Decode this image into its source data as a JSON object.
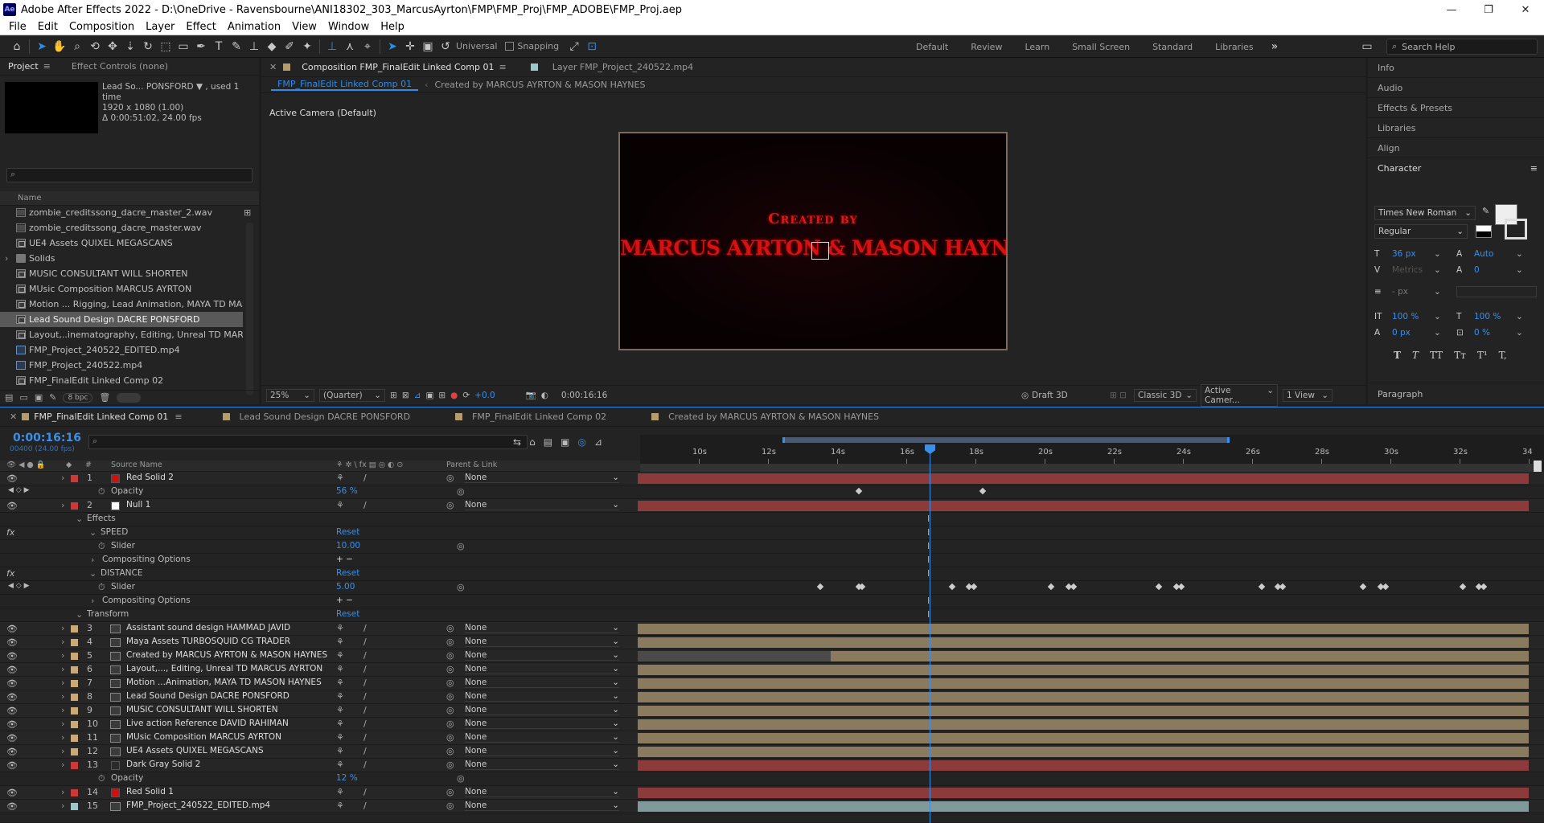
{
  "app": {
    "logo": "Ae",
    "title": "Adobe After Effects 2022 - D:\\OneDrive - Ravensbourne\\ANI18302_303_MarcusAyrton\\FMP\\FMP_Proj\\FMP_ADOBE\\FMP_Proj.aep"
  },
  "menu": [
    "File",
    "Edit",
    "Composition",
    "Layer",
    "Effect",
    "Animation",
    "View",
    "Window",
    "Help"
  ],
  "toolbar": {
    "universal": "Universal",
    "snapping": "Snapping",
    "workspaces": [
      "Default",
      "Review",
      "Learn",
      "Small Screen",
      "Standard",
      "Libraries"
    ],
    "more": "»",
    "search_placeholder": "Search Help"
  },
  "project": {
    "tabs": [
      "Project",
      "Effect Controls (none)"
    ],
    "preview_info": [
      "Lead So... PONSFORD ▼ , used 1 time",
      "1920 x 1080 (1.00)",
      "Δ 0:00:51:02, 24.00 fps"
    ],
    "name_header": "Name",
    "items": [
      {
        "label": "zombie_creditssong_dacre_master_2.wav",
        "type": "wav"
      },
      {
        "label": "zombie_creditssong_dacre_master.wav",
        "type": "wav"
      },
      {
        "label": "UE4 Assets QUIXEL MEGASCANS",
        "type": "comp"
      },
      {
        "label": "Solids",
        "type": "folder"
      },
      {
        "label": "MUSIC CONSULTANT WILL SHORTEN",
        "type": "comp"
      },
      {
        "label": "MUsic Composition MARCUS AYRTON",
        "type": "comp"
      },
      {
        "label": "Motion ... Rigging,  Lead Animation, MAYA TD MASON",
        "type": "comp"
      },
      {
        "label": "Lead Sound Design DACRE PONSFORD",
        "type": "comp",
        "selected": true
      },
      {
        "label": "Layout,..inematography, Editing, Unreal TD MARCUS A",
        "type": "comp"
      },
      {
        "label": "FMP_Project_240522_EDITED.mp4",
        "type": "mp4"
      },
      {
        "label": "FMP_Project_240522.mp4",
        "type": "mp4"
      },
      {
        "label": "FMP_FinalEdit Linked Comp 02",
        "type": "comp"
      }
    ],
    "bpc": "8 bpc"
  },
  "viewer": {
    "tabs": [
      "Composition FMP_FinalEdit Linked Comp 01",
      "Layer FMP_Project_240522.mp4"
    ],
    "breadcrumb": [
      "FMP_FinalEdit Linked Comp 01",
      "Created by MARCUS AYRTON & MASON HAYNES"
    ],
    "camera": "Active Camera (Default)",
    "credit_line1": "Created by",
    "credit_line2": "MARCUS AYRTON & MASON HAYNES",
    "zoom": "25%",
    "resolution": "(Quarter)",
    "exposure": "+0.0",
    "timecode": "0:00:16:16",
    "renderer_label": "Draft 3D",
    "renderer": "Classic 3D",
    "camera_select": "Active Camer...",
    "views": "1 View"
  },
  "right_panel": {
    "items": [
      "Info",
      "Audio",
      "Effects & Presets",
      "Libraries",
      "Align"
    ],
    "character": {
      "title": "Character",
      "font": "Times New Roman",
      "style": "Regular",
      "size": "36 px",
      "leading": "Auto",
      "kerning": "Metrics",
      "tracking": "0",
      "stroke": "- px",
      "vscale": "100 %",
      "hscale": "100 %",
      "baseline": "0 px",
      "tsume": "0 %",
      "styles": [
        "T",
        "T",
        "TT",
        "Tт",
        "T¹",
        "T,"
      ]
    },
    "paragraph": "Paragraph"
  },
  "timeline": {
    "tabs": [
      "FMP_FinalEdit Linked Comp 01",
      "Lead Sound Design DACRE PONSFORD",
      "FMP_FinalEdit Linked Comp 02",
      "Created by MARCUS AYRTON & MASON HAYNES"
    ],
    "timecode": "0:00:16:16",
    "frames": "00400 (24.00 fps)",
    "columns": {
      "hash": "#",
      "source": "Source Name",
      "parent": "Parent & Link"
    },
    "ruler": [
      "10s",
      "12s",
      "14s",
      "16s",
      "18s",
      "20s",
      "22s",
      "24s",
      "26s",
      "28s",
      "30s",
      "32s",
      "34"
    ],
    "rows": [
      {
        "num": "1",
        "name": "Red Solid 2",
        "label": "#c93a3a",
        "swatch": "#d01010",
        "parent": "None",
        "bar": "#8c3a3a",
        "kind": "layer"
      },
      {
        "name": "Opacity",
        "value": "56 %",
        "kind": "prop"
      },
      {
        "num": "2",
        "name": "Null 1",
        "label": "#c93a3a",
        "swatch": "#ffffff",
        "parent": "None",
        "bar": "#8c3a3a",
        "kind": "layer"
      },
      {
        "name": "Effects",
        "kind": "group"
      },
      {
        "name": "SPEED",
        "value": "Reset",
        "kind": "effect"
      },
      {
        "name": "Slider",
        "value": "10.00",
        "kind": "prop"
      },
      {
        "name": "Compositing Options",
        "value": "+ −",
        "kind": "sub"
      },
      {
        "name": "DISTANCE",
        "value": "Reset",
        "kind": "effect"
      },
      {
        "name": "Slider",
        "value": "5.00",
        "kind": "prop"
      },
      {
        "name": "Compositing Options",
        "value": "+ −",
        "kind": "sub"
      },
      {
        "name": "Transform",
        "value": "Reset",
        "kind": "group"
      },
      {
        "num": "3",
        "name": "Assistant sound design HAMMAD JAVID",
        "label": "#c9a97a",
        "parent": "None",
        "bar": "#8a7a5e",
        "kind": "layer"
      },
      {
        "num": "4",
        "name": " Maya Assets TURBOSQUID CG TRADER",
        "label": "#c9a97a",
        "parent": "None",
        "bar": "#8a7a5e",
        "kind": "layer"
      },
      {
        "num": "5",
        "name": "Created by MARCUS AYRTON & MASON HAYNES",
        "label": "#c9a97a",
        "parent": "None",
        "bar": "#8a7a5e",
        "kind": "layer"
      },
      {
        "num": "6",
        "name": "Layout,..., Editing, Unreal TD MARCUS AYRTON",
        "label": "#c9a97a",
        "parent": "None",
        "bar": "#8a7a5e",
        "kind": "layer"
      },
      {
        "num": "7",
        "name": "Motion ...Animation, MAYA TD MASON HAYNES",
        "label": "#c9a97a",
        "parent": "None",
        "bar": "#8a7a5e",
        "kind": "layer"
      },
      {
        "num": "8",
        "name": "Lead Sound Design DACRE PONSFORD",
        "label": "#c9a97a",
        "parent": "None",
        "bar": "#8a7a5e",
        "kind": "layer"
      },
      {
        "num": "9",
        "name": "MUSIC CONSULTANT WILL SHORTEN",
        "label": "#c9a97a",
        "parent": "None",
        "bar": "#8a7a5e",
        "kind": "layer"
      },
      {
        "num": "10",
        "name": " Live action Reference DAVID RAHIMAN",
        "label": "#c9a97a",
        "parent": "None",
        "bar": "#8a7a5e",
        "kind": "layer"
      },
      {
        "num": "11",
        "name": "MUsic Composition MARCUS AYRTON",
        "label": "#c9a97a",
        "parent": "None",
        "bar": "#8a7a5e",
        "kind": "layer"
      },
      {
        "num": "12",
        "name": "UE4 Assets QUIXEL MEGASCANS",
        "label": "#c9a97a",
        "parent": "None",
        "bar": "#8a7a5e",
        "kind": "layer"
      },
      {
        "num": "13",
        "name": "Dark Gray Solid 2",
        "label": "#c93a3a",
        "swatch": "#2a2a2a",
        "parent": "None",
        "bar": "#8c3a3a",
        "kind": "layer"
      },
      {
        "name": "Opacity",
        "value": "12 %",
        "kind": "prop"
      },
      {
        "num": "14",
        "name": "Red Solid 1",
        "label": "#c93a3a",
        "swatch": "#d01010",
        "parent": "None",
        "bar": "#8c3a3a",
        "kind": "layer"
      },
      {
        "num": "15",
        "name": "FMP_Project_240522_EDITED.mp4",
        "label": "#9cc8c8",
        "parent": "None",
        "bar": "#7e9a9a",
        "kind": "layer"
      }
    ]
  }
}
